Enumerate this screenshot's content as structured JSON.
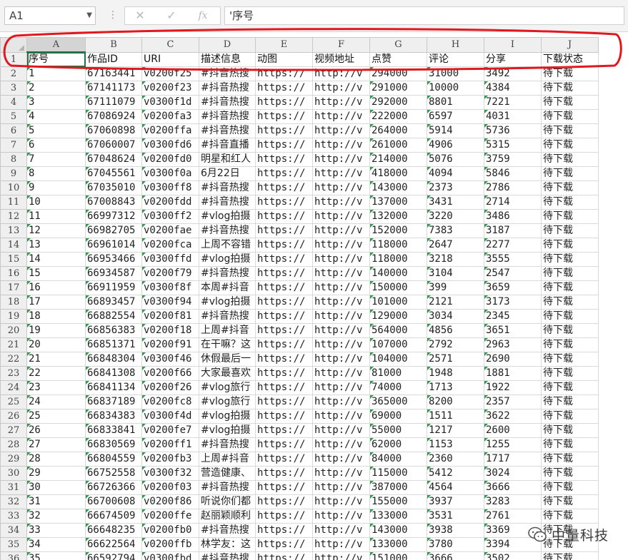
{
  "formula_bar": {
    "name_box": "A1",
    "cancel_symbol": "✕",
    "enter_symbol": "✓",
    "fx_symbol": "fx",
    "content": "'序号"
  },
  "sheet": {
    "columns": [
      "A",
      "B",
      "C",
      "D",
      "E",
      "F",
      "G",
      "H",
      "I",
      "J"
    ],
    "selected_column": "A",
    "active_cell": "A1",
    "headers": [
      "序号",
      "作品ID",
      "URI",
      "描述信息",
      "动图",
      "视频地址",
      "点赞",
      "评论",
      "分享",
      "下载状态"
    ],
    "header_row_number": "1",
    "rows": [
      {
        "n": "2",
        "a": "1",
        "b": "67163441",
        "c": "v0200f25",
        "d": "#抖音热搜",
        "e": "https://",
        "f": "http://v",
        "g": "294000",
        "h": "31000",
        "i": "3492",
        "j": "待下载"
      },
      {
        "n": "3",
        "a": "2",
        "b": "67141173",
        "c": "v0200f23",
        "d": "#抖音热搜",
        "e": "https://",
        "f": "http://v",
        "g": "291000",
        "h": "10000",
        "i": "4384",
        "j": "待下载"
      },
      {
        "n": "4",
        "a": "3",
        "b": "67111079",
        "c": "v0300f1d",
        "d": "#抖音热搜",
        "e": "https://",
        "f": "http://v",
        "g": "292000",
        "h": "8801",
        "i": "7221",
        "j": "待下载"
      },
      {
        "n": "5",
        "a": "4",
        "b": "67086924",
        "c": "v0200fa3",
        "d": "#抖音热搜",
        "e": "https://",
        "f": "http://v",
        "g": "222000",
        "h": "6597",
        "i": "4031",
        "j": "待下载"
      },
      {
        "n": "6",
        "a": "5",
        "b": "67060898",
        "c": "v0200ffa",
        "d": "#抖音热搜",
        "e": "https://",
        "f": "http://v",
        "g": "264000",
        "h": "5914",
        "i": "5736",
        "j": "待下载"
      },
      {
        "n": "7",
        "a": "6",
        "b": "67060007",
        "c": "v0300fd6",
        "d": "#抖音直播",
        "e": "https://",
        "f": "http://v",
        "g": "261000",
        "h": "4906",
        "i": "5315",
        "j": "待下载"
      },
      {
        "n": "8",
        "a": "7",
        "b": "67048624",
        "c": "v0200fd0",
        "d": "明星和红人",
        "e": "https://",
        "f": "http://v",
        "g": "214000",
        "h": "5076",
        "i": "3759",
        "j": "待下载"
      },
      {
        "n": "9",
        "a": "8",
        "b": "67045561",
        "c": "v0300f0a",
        "d": "6月22日",
        "e": "https://",
        "f": "http://v",
        "g": "418000",
        "h": "4094",
        "i": "5846",
        "j": "待下载"
      },
      {
        "n": "10",
        "a": "9",
        "b": "67035010",
        "c": "v0300ff8",
        "d": "#抖音热搜",
        "e": "https://",
        "f": "http://v",
        "g": "143000",
        "h": "2373",
        "i": "2786",
        "j": "待下载"
      },
      {
        "n": "11",
        "a": "10",
        "b": "67008843",
        "c": "v0200fdd",
        "d": "#抖音热搜",
        "e": "https://",
        "f": "http://v",
        "g": "137000",
        "h": "3431",
        "i": "2714",
        "j": "待下载"
      },
      {
        "n": "12",
        "a": "11",
        "b": "66997312",
        "c": "v0300ff2",
        "d": "#vlog拍摄",
        "e": "https://",
        "f": "http://v",
        "g": "132000",
        "h": "3220",
        "i": "3486",
        "j": "待下载"
      },
      {
        "n": "13",
        "a": "12",
        "b": "66982705",
        "c": "v0200fae",
        "d": "#抖音热搜",
        "e": "https://",
        "f": "http://v",
        "g": "152000",
        "h": "7383",
        "i": "3187",
        "j": "待下载"
      },
      {
        "n": "14",
        "a": "13",
        "b": "66961014",
        "c": "v0200fca",
        "d": "上周不容错",
        "e": "https://",
        "f": "http://v",
        "g": "118000",
        "h": "2647",
        "i": "2277",
        "j": "待下载"
      },
      {
        "n": "15",
        "a": "14",
        "b": "66953466",
        "c": "v0300ffd",
        "d": "#vlog拍摄",
        "e": "https://",
        "f": "http://v",
        "g": "118000",
        "h": "3218",
        "i": "3555",
        "j": "待下载"
      },
      {
        "n": "16",
        "a": "15",
        "b": "66934587",
        "c": "v0200f79",
        "d": "#抖音热搜",
        "e": "https://",
        "f": "http://v",
        "g": "140000",
        "h": "3104",
        "i": "2547",
        "j": "待下载"
      },
      {
        "n": "17",
        "a": "16",
        "b": "66911959",
        "c": "v0300f8f",
        "d": "本周#抖音",
        "e": "https://",
        "f": "http://v",
        "g": "150000",
        "h": "399",
        "i": "3659",
        "j": "待下载"
      },
      {
        "n": "18",
        "a": "17",
        "b": "66893457",
        "c": "v0300f94",
        "d": "#vlog拍摄",
        "e": "https://",
        "f": "http://v",
        "g": "101000",
        "h": "2121",
        "i": "3173",
        "j": "待下载"
      },
      {
        "n": "19",
        "a": "18",
        "b": "66882554",
        "c": "v0200f81",
        "d": "#抖音热搜",
        "e": "https://",
        "f": "http://v",
        "g": "129000",
        "h": "3034",
        "i": "2345",
        "j": "待下载"
      },
      {
        "n": "20",
        "a": "19",
        "b": "66856383",
        "c": "v0200f18",
        "d": "上周#抖音",
        "e": "https://",
        "f": "http://v",
        "g": "564000",
        "h": "4856",
        "i": "3651",
        "j": "待下载"
      },
      {
        "n": "21",
        "a": "20",
        "b": "66851371",
        "c": "v0200f91",
        "d": "在干嘛？这",
        "e": "https://",
        "f": "http://v",
        "g": "107000",
        "h": "2792",
        "i": "2963",
        "j": "待下载"
      },
      {
        "n": "22",
        "a": "21",
        "b": "66848304",
        "c": "v0300f46",
        "d": "休假最后一",
        "e": "https://",
        "f": "http://v",
        "g": "104000",
        "h": "2571",
        "i": "2690",
        "j": "待下载"
      },
      {
        "n": "23",
        "a": "22",
        "b": "66841308",
        "c": "v0200f66",
        "d": "大家最喜欢",
        "e": "https://",
        "f": "http://v",
        "g": "81000",
        "h": "1948",
        "i": "1881",
        "j": "待下载"
      },
      {
        "n": "24",
        "a": "23",
        "b": "66841134",
        "c": "v0200f26",
        "d": "#vlog旅行",
        "e": "https://",
        "f": "http://v",
        "g": "74000",
        "h": "1713",
        "i": "1922",
        "j": "待下载"
      },
      {
        "n": "25",
        "a": "24",
        "b": "66837189",
        "c": "v0200fc8",
        "d": "#vlog旅行",
        "e": "https://",
        "f": "http://v",
        "g": "365000",
        "h": "8200",
        "i": "2357",
        "j": "待下载"
      },
      {
        "n": "26",
        "a": "25",
        "b": "66834383",
        "c": "v0300f4d",
        "d": "#vlog拍摄",
        "e": "https://",
        "f": "http://v",
        "g": "69000",
        "h": "1511",
        "i": "3622",
        "j": "待下载"
      },
      {
        "n": "27",
        "a": "26",
        "b": "66833841",
        "c": "v0200fe7",
        "d": "#vlog拍摄",
        "e": "https://",
        "f": "http://v",
        "g": "55000",
        "h": "1217",
        "i": "2600",
        "j": "待下载"
      },
      {
        "n": "28",
        "a": "27",
        "b": "66830569",
        "c": "v0200ff1",
        "d": "#抖音热搜",
        "e": "https://",
        "f": "http://v",
        "g": "62000",
        "h": "1153",
        "i": "1255",
        "j": "待下载"
      },
      {
        "n": "29",
        "a": "28",
        "b": "66804559",
        "c": "v0200fb3",
        "d": "上周#抖音",
        "e": "https://",
        "f": "http://v",
        "g": "84000",
        "h": "2360",
        "i": "1717",
        "j": "待下载"
      },
      {
        "n": "30",
        "a": "29",
        "b": "66752558",
        "c": "v0300f32",
        "d": "营造健康、",
        "e": "https://",
        "f": "http://v",
        "g": "115000",
        "h": "5412",
        "i": "3024",
        "j": "待下载"
      },
      {
        "n": "31",
        "a": "30",
        "b": "66726366",
        "c": "v0200f03",
        "d": "#抖音热搜",
        "e": "https://",
        "f": "http://v",
        "g": "387000",
        "h": "4564",
        "i": "3666",
        "j": "待下载"
      },
      {
        "n": "32",
        "a": "31",
        "b": "66700608",
        "c": "v0200f86",
        "d": "听说你们都",
        "e": "https://",
        "f": "http://v",
        "g": "155000",
        "h": "3937",
        "i": "3283",
        "j": "待下载"
      },
      {
        "n": "33",
        "a": "32",
        "b": "66674509",
        "c": "v0200ffe",
        "d": "赵丽颖顺利",
        "e": "https://",
        "f": "http://v",
        "g": "133000",
        "h": "3531",
        "i": "2761",
        "j": "待下载"
      },
      {
        "n": "34",
        "a": "33",
        "b": "66648235",
        "c": "v0200fb0",
        "d": "#抖音热搜",
        "e": "https://",
        "f": "http://v",
        "g": "143000",
        "h": "3938",
        "i": "3369",
        "j": "待下载"
      },
      {
        "n": "35",
        "a": "34",
        "b": "66622564",
        "c": "v0200ffb",
        "d": "林学友：这",
        "e": "https://",
        "f": "http://v",
        "g": "133000",
        "h": "3780",
        "i": "3394",
        "j": "待下载"
      },
      {
        "n": "36",
        "a": "35",
        "b": "66592794",
        "c": "v0300fbd",
        "d": "#抖音热搜",
        "e": "https://",
        "f": "http://v",
        "g": "151000",
        "h": "3666",
        "i": "3502",
        "j": "待下载"
      }
    ]
  },
  "watermark": {
    "icon": "wechat-icon",
    "text": "中量科技"
  },
  "colors": {
    "annotation": "#e0191e",
    "selection": "#217346",
    "error_triangle": "#2e9a4a"
  }
}
